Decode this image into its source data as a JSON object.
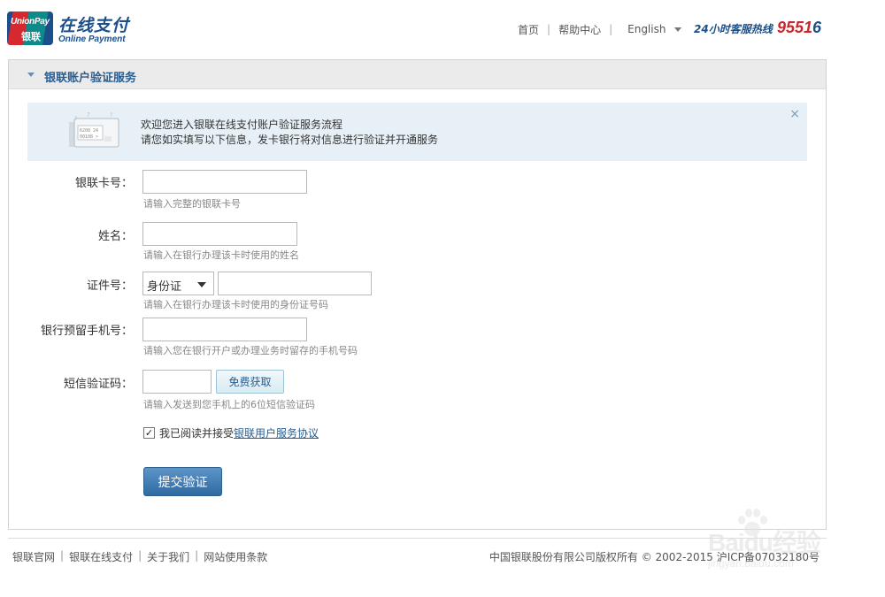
{
  "header": {
    "logo_top": "UnionPay",
    "logo_bottom": "银联",
    "brand_cn": "在线支付",
    "brand_en": "Online Payment",
    "nav": [
      {
        "label": "首页"
      },
      {
        "label": "帮助中心"
      }
    ],
    "language": "English",
    "hotline_label": "24小时客服热线",
    "hotline_number_a": "9551",
    "hotline_number_b": "6"
  },
  "panel": {
    "title": "银联账户验证服务"
  },
  "notice": {
    "line1": "欢迎您进入银联在线支付账户验证服务流程",
    "line2": "请您如实填写以下信息，发卡银行将对信息进行验证并开通服务",
    "close": "×",
    "card_text1": "6208 24",
    "card_text2": "00108 >"
  },
  "form": {
    "card_number": {
      "label": "银联卡号：",
      "value": "",
      "hint": "请输入完整的银联卡号"
    },
    "name": {
      "label": "姓名：",
      "value": "",
      "hint": "请输入在银行办理该卡时使用的姓名"
    },
    "id": {
      "label": "证件号：",
      "type": "身份证",
      "value": "",
      "hint": "请输入在银行办理该卡时使用的身份证号码"
    },
    "phone": {
      "label": "银行预留手机号：",
      "value": "",
      "hint": "请输入您在银行开户或办理业务时留存的手机号码"
    },
    "sms": {
      "label": "短信验证码：",
      "value": "",
      "button": "免费获取",
      "hint": "请输入发送到您手机上的6位短信验证码"
    },
    "agree_text": "我已阅读并接受",
    "agree_link": "银联用户服务协议",
    "agree_checked": true,
    "checkmark": "✓",
    "submit": "提交验证"
  },
  "footer": {
    "links": [
      {
        "label": "银联官网"
      },
      {
        "label": "银联在线支付"
      },
      {
        "label": "关于我们"
      },
      {
        "label": "网站使用条款"
      }
    ],
    "copyright": "中国银联股份有限公司版权所有 © 2002-2015 沪ICP备07032180号"
  },
  "watermark": {
    "text": "Baidu经验",
    "sub": "jingyan.baidu.com"
  },
  "colors": {
    "brand_blue": "#1a4f8b",
    "brand_red": "#c8282e",
    "notice_bg": "#e7f0f6",
    "submit_blue": "#2f6aa3"
  }
}
